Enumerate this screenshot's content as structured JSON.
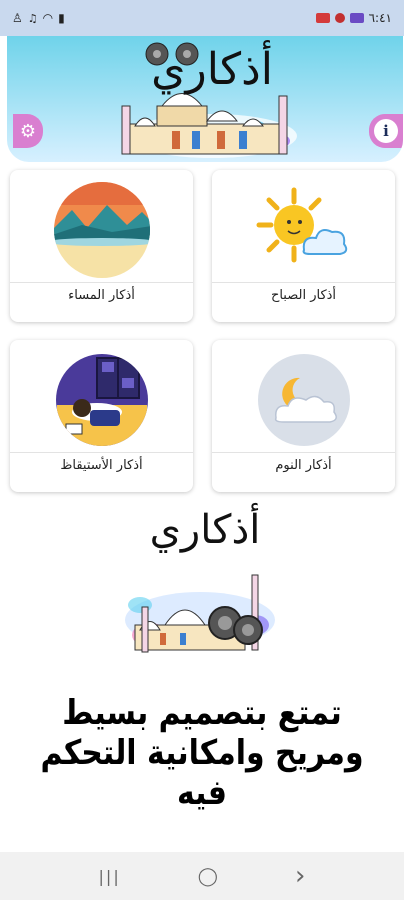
{
  "status_bar": {
    "time": "٦:٤١",
    "icons": [
      "notification-icon",
      "ringtone-icon",
      "wifi-icon",
      "signal-icon",
      "battery-icon"
    ]
  },
  "header": {
    "logo_text": "أذكاري",
    "settings_icon": "gear-icon",
    "info_icon": "info-icon",
    "info_glyph": "i"
  },
  "cards": [
    {
      "label": "أذكار الصباح",
      "icon": "sun-cloud-icon"
    },
    {
      "label": "أذكار المساء",
      "icon": "sunset-landscape-icon"
    },
    {
      "label": "أذكار النوم",
      "icon": "moon-cloud-icon"
    },
    {
      "label": "أذكار الأستيقاظ",
      "icon": "waking-person-icon"
    }
  ],
  "promo": {
    "logo_text": "أذكاري",
    "tagline": "تمتع بتصميم بسيط ومريح وامكانية التحكم فيه"
  },
  "nav": {
    "recents": "|||",
    "home": "◯",
    "back": "›"
  },
  "colors": {
    "header_gradient_top": "#6fd3ea",
    "side_button": "#d97fd0",
    "card_bg": "#ffffff"
  }
}
